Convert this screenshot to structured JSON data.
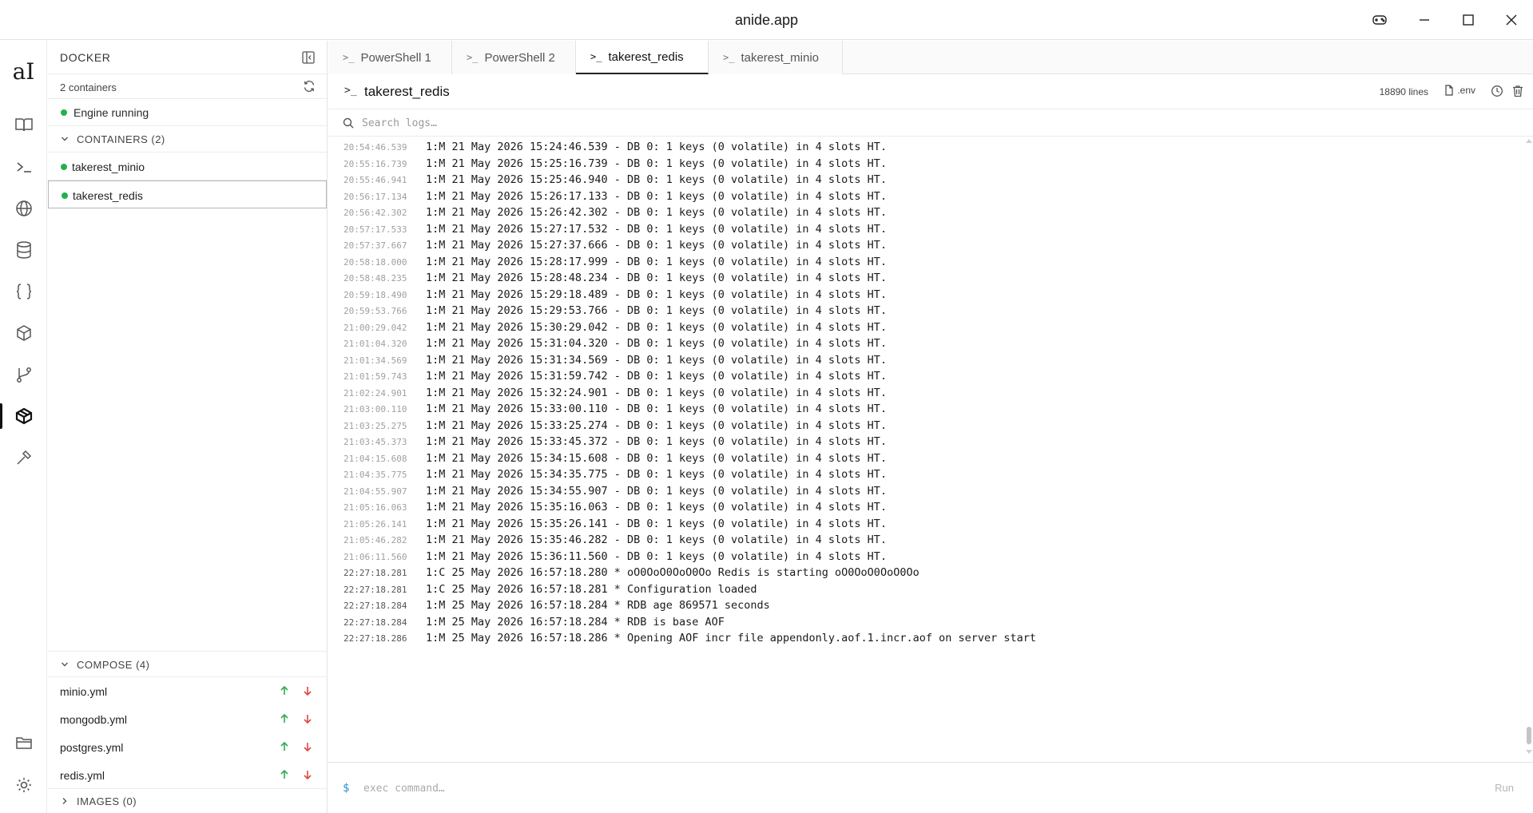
{
  "window": {
    "title": "anide.app"
  },
  "rail": {
    "logo": "aI",
    "items": [
      {
        "icon": "book-icon"
      },
      {
        "icon": "terminal-icon"
      },
      {
        "icon": "globe-icon"
      },
      {
        "icon": "database-icon"
      },
      {
        "icon": "braces-icon"
      },
      {
        "icon": "package-icon"
      },
      {
        "icon": "git-branch-icon"
      },
      {
        "icon": "docker-icon",
        "active": true
      },
      {
        "icon": "hammer-icon"
      }
    ],
    "bottom": [
      {
        "icon": "folder-icon"
      },
      {
        "icon": "sun-icon"
      }
    ]
  },
  "docker": {
    "title": "DOCKER",
    "count_label": "2 containers",
    "engine_status": "Engine running",
    "containers_header": "CONTAINERS (2)",
    "containers": [
      {
        "name": "takerest_minio",
        "status_color": "#22b14c",
        "selected": false
      },
      {
        "name": "takerest_redis",
        "status_color": "#22b14c",
        "selected": true
      }
    ],
    "compose_header": "COMPOSE (4)",
    "compose": [
      {
        "name": "minio.yml"
      },
      {
        "name": "mongodb.yml"
      },
      {
        "name": "postgres.yml"
      },
      {
        "name": "redis.yml"
      }
    ],
    "images_header": "IMAGES (0)"
  },
  "tabs": [
    {
      "label": "PowerShell 1",
      "active": false
    },
    {
      "label": "PowerShell 2",
      "active": false
    },
    {
      "label": "takerest_redis",
      "active": true
    },
    {
      "label": "takerest_minio",
      "active": false
    }
  ],
  "log_header": {
    "name": "takerest_redis",
    "line_count": "18890 lines",
    "env_label": ".env"
  },
  "search": {
    "placeholder": "Search logs…"
  },
  "logs": [
    {
      "ts": "20:54:46.539",
      "msg": "1:M 21 May 2026 15:24:46.539 - DB 0: 1 keys (0 volatile) in 4 slots HT."
    },
    {
      "ts": "20:55:16.739",
      "msg": "1:M 21 May 2026 15:25:16.739 - DB 0: 1 keys (0 volatile) in 4 slots HT."
    },
    {
      "ts": "20:55:46.941",
      "msg": "1:M 21 May 2026 15:25:46.940 - DB 0: 1 keys (0 volatile) in 4 slots HT."
    },
    {
      "ts": "20:56:17.134",
      "msg": "1:M 21 May 2026 15:26:17.133 - DB 0: 1 keys (0 volatile) in 4 slots HT."
    },
    {
      "ts": "20:56:42.302",
      "msg": "1:M 21 May 2026 15:26:42.302 - DB 0: 1 keys (0 volatile) in 4 slots HT."
    },
    {
      "ts": "20:57:17.533",
      "msg": "1:M 21 May 2026 15:27:17.532 - DB 0: 1 keys (0 volatile) in 4 slots HT."
    },
    {
      "ts": "20:57:37.667",
      "msg": "1:M 21 May 2026 15:27:37.666 - DB 0: 1 keys (0 volatile) in 4 slots HT."
    },
    {
      "ts": "20:58:18.000",
      "msg": "1:M 21 May 2026 15:28:17.999 - DB 0: 1 keys (0 volatile) in 4 slots HT."
    },
    {
      "ts": "20:58:48.235",
      "msg": "1:M 21 May 2026 15:28:48.234 - DB 0: 1 keys (0 volatile) in 4 slots HT."
    },
    {
      "ts": "20:59:18.490",
      "msg": "1:M 21 May 2026 15:29:18.489 - DB 0: 1 keys (0 volatile) in 4 slots HT."
    },
    {
      "ts": "20:59:53.766",
      "msg": "1:M 21 May 2026 15:29:53.766 - DB 0: 1 keys (0 volatile) in 4 slots HT."
    },
    {
      "ts": "21:00:29.042",
      "msg": "1:M 21 May 2026 15:30:29.042 - DB 0: 1 keys (0 volatile) in 4 slots HT."
    },
    {
      "ts": "21:01:04.320",
      "msg": "1:M 21 May 2026 15:31:04.320 - DB 0: 1 keys (0 volatile) in 4 slots HT."
    },
    {
      "ts": "21:01:34.569",
      "msg": "1:M 21 May 2026 15:31:34.569 - DB 0: 1 keys (0 volatile) in 4 slots HT."
    },
    {
      "ts": "21:01:59.743",
      "msg": "1:M 21 May 2026 15:31:59.742 - DB 0: 1 keys (0 volatile) in 4 slots HT."
    },
    {
      "ts": "21:02:24.901",
      "msg": "1:M 21 May 2026 15:32:24.901 - DB 0: 1 keys (0 volatile) in 4 slots HT."
    },
    {
      "ts": "21:03:00.110",
      "msg": "1:M 21 May 2026 15:33:00.110 - DB 0: 1 keys (0 volatile) in 4 slots HT."
    },
    {
      "ts": "21:03:25.275",
      "msg": "1:M 21 May 2026 15:33:25.274 - DB 0: 1 keys (0 volatile) in 4 slots HT."
    },
    {
      "ts": "21:03:45.373",
      "msg": "1:M 21 May 2026 15:33:45.372 - DB 0: 1 keys (0 volatile) in 4 slots HT."
    },
    {
      "ts": "21:04:15.608",
      "msg": "1:M 21 May 2026 15:34:15.608 - DB 0: 1 keys (0 volatile) in 4 slots HT."
    },
    {
      "ts": "21:04:35.775",
      "msg": "1:M 21 May 2026 15:34:35.775 - DB 0: 1 keys (0 volatile) in 4 slots HT."
    },
    {
      "ts": "21:04:55.907",
      "msg": "1:M 21 May 2026 15:34:55.907 - DB 0: 1 keys (0 volatile) in 4 slots HT."
    },
    {
      "ts": "21:05:16.063",
      "msg": "1:M 21 May 2026 15:35:16.063 - DB 0: 1 keys (0 volatile) in 4 slots HT."
    },
    {
      "ts": "21:05:26.141",
      "msg": "1:M 21 May 2026 15:35:26.141 - DB 0: 1 keys (0 volatile) in 4 slots HT."
    },
    {
      "ts": "21:05:46.282",
      "msg": "1:M 21 May 2026 15:35:46.282 - DB 0: 1 keys (0 volatile) in 4 slots HT."
    },
    {
      "ts": "21:06:11.560",
      "msg": "1:M 21 May 2026 15:36:11.560 - DB 0: 1 keys (0 volatile) in 4 slots HT."
    },
    {
      "ts": "22:27:18.281",
      "msg": "1:C 25 May 2026 16:57:18.280 * oO0OoO0OoO0Oo Redis is starting oO0OoO0OoO0Oo"
    },
    {
      "ts": "22:27:18.281",
      "msg": "1:C 25 May 2026 16:57:18.281 * Configuration loaded"
    },
    {
      "ts": "22:27:18.284",
      "msg": "1:M 25 May 2026 16:57:18.284 * RDB age 869571 seconds"
    },
    {
      "ts": "22:27:18.284",
      "msg": "1:M 25 May 2026 16:57:18.284 * RDB is base AOF"
    },
    {
      "ts": "22:27:18.286",
      "msg": "1:M 25 May 2026 16:57:18.286 * Opening AOF incr file appendonly.aof.1.incr.aof on server start"
    }
  ],
  "command": {
    "prompt": "$",
    "placeholder": "exec command…",
    "run_label": "Run"
  },
  "colors": {
    "status_green": "#22b14c",
    "compose_up": "#2eaa4f",
    "compose_down": "#e0443e",
    "prompt_blue": "#2a8fd6"
  }
}
